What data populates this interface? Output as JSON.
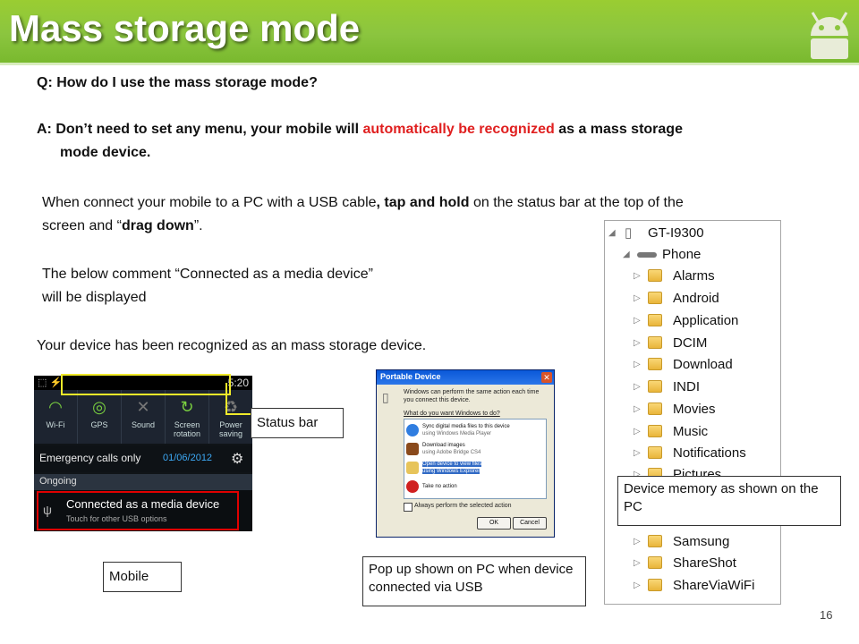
{
  "slide": {
    "title": "Mass storage mode",
    "page_number": "16"
  },
  "qa": {
    "question": "Q: How do I use the mass storage mode?",
    "answer_part1": "A: Don’t need to set any menu, your mobile will ",
    "answer_highlight": "automatically be recognized",
    "answer_part2": " as a mass storage",
    "answer_line2": "mode device."
  },
  "instructions": {
    "p1_a": "When connect your mobile to a PC with a USB cable",
    "p1_b": ", tap and hold",
    "p1_c": " on the status bar at the top of the",
    "p1_d": "screen and “",
    "p1_e": "drag down",
    "p1_f": "”.",
    "p2_line1": "The below comment “Connected as a media device”",
    "p2_line2": "will be displayed",
    "p3": "Your device has been recognized as an mass storage device."
  },
  "phone": {
    "time": "5:20",
    "quick_settings": [
      "Wi-Fi",
      "GPS",
      "Sound",
      "Screen rotation",
      "Power saving"
    ],
    "emergency": "Emergency calls only",
    "date": "01/06/2012",
    "ongoing": "Ongoing",
    "notification_title": "Connected as a media device",
    "notification_sub": "Touch for other USB options"
  },
  "callouts": {
    "status_bar": "Status bar",
    "mobile": "Mobile",
    "popup": "Pop up shown on PC when device connected via USB",
    "device_memory": "Device memory as shown on the PC"
  },
  "dialog": {
    "title": "Portable Device",
    "intro": "Windows can perform the same action each time you connect this device.",
    "question": "What do you want Windows to do?",
    "items": [
      {
        "title": "Sync digital media files to this device",
        "sub": "using Windows Media Player"
      },
      {
        "title": "Download images",
        "sub": "using Adobe Bridge CS4"
      },
      {
        "title": "Open device to view files",
        "sub": "using Windows Explorer"
      },
      {
        "title": "Take no action",
        "sub": ""
      }
    ],
    "always": "Always perform the selected action",
    "ok": "OK",
    "cancel": "Cancel"
  },
  "tree": {
    "root": "GT-I9300",
    "phone": "Phone",
    "folders": [
      "Alarms",
      "Android",
      "Application",
      "DCIM",
      "Download",
      "INDI",
      "Movies",
      "Music",
      "Notifications",
      "Pictures",
      "Samsung",
      "ShareShot",
      "ShareViaWiFi"
    ]
  },
  "colors": {
    "title_green": "#8bc53f",
    "highlight_red": "#e02020",
    "status_bar_box": "#f0ea2a"
  }
}
